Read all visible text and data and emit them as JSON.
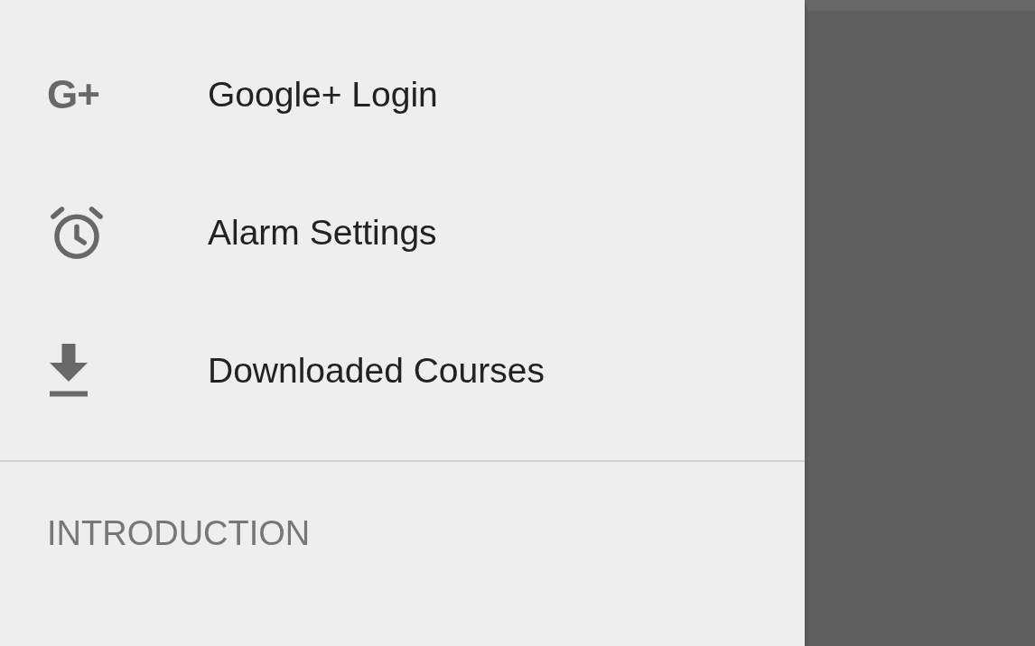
{
  "drawer": {
    "items": [
      {
        "kind": "glyph",
        "glyph": "G+",
        "label": "Google+ Login"
      },
      {
        "kind": "alarm",
        "label": "Alarm Settings"
      },
      {
        "kind": "download",
        "label": "Downloaded Courses"
      }
    ],
    "section_header": "INTRODUCTION"
  }
}
